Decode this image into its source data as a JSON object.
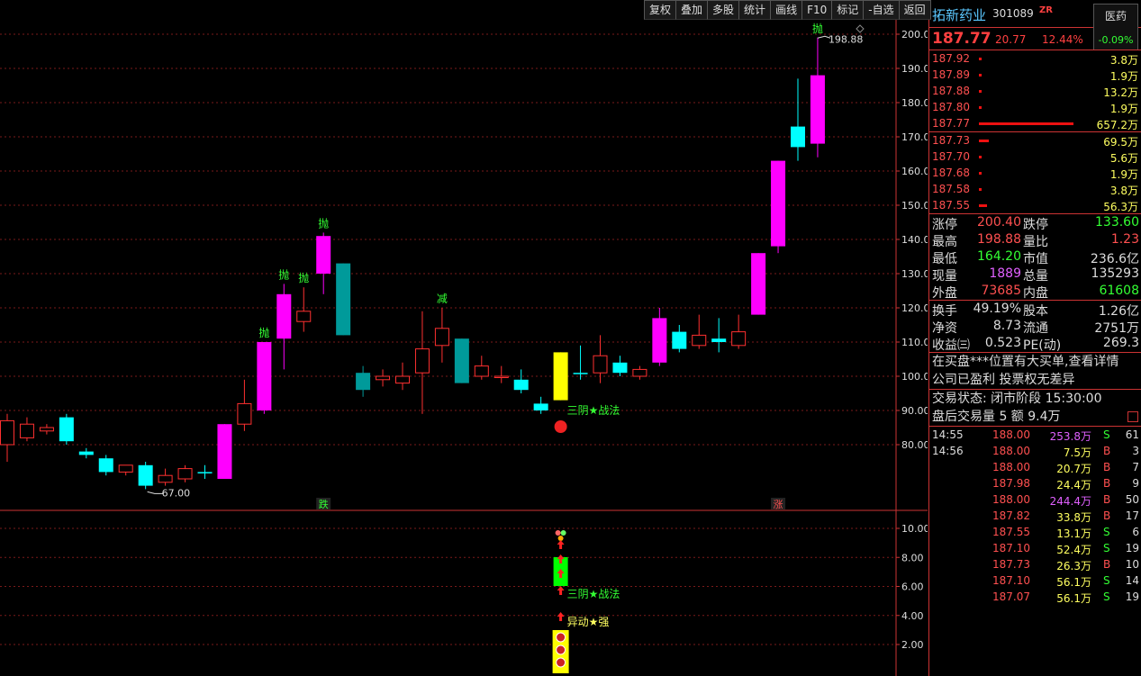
{
  "toolbar": [
    "复权",
    "叠加",
    "多股",
    "统计",
    "画线",
    "F10",
    "标记",
    "-自选",
    "返回"
  ],
  "stock": {
    "name": "拓新药业",
    "code": "301089",
    "tag": "ZR",
    "sector": "医药",
    "sector_change": "-0.09%",
    "price": "187.77",
    "change": "20.77",
    "change_pct": "12.44%"
  },
  "order_book": [
    {
      "price": "187.92",
      "vol": "3.8万",
      "bar": 0.01
    },
    {
      "price": "187.89",
      "vol": "1.9万",
      "bar": 0.01
    },
    {
      "price": "187.88",
      "vol": "13.2万",
      "bar": 0.01
    },
    {
      "price": "187.80",
      "vol": "1.9万",
      "bar": 0.01
    },
    {
      "price": "187.77",
      "vol": "657.2万",
      "bar": 0.95
    },
    {
      "price": "187.73",
      "vol": "69.5万",
      "bar": 0.1
    },
    {
      "price": "187.70",
      "vol": "5.6万",
      "bar": 0.01
    },
    {
      "price": "187.68",
      "vol": "1.9万",
      "bar": 0.01
    },
    {
      "price": "187.58",
      "vol": "3.8万",
      "bar": 0.01
    },
    {
      "price": "187.55",
      "vol": "56.3万",
      "bar": 0.08
    }
  ],
  "stats": [
    [
      {
        "l": "涨停",
        "v": "200.40",
        "c": "#ff5050"
      },
      {
        "l": "跌停",
        "v": "133.60",
        "c": "#3f3"
      }
    ],
    [
      {
        "l": "最高",
        "v": "198.88",
        "c": "#ff5050"
      },
      {
        "l": "量比",
        "v": "1.23",
        "c": "#ff5050"
      }
    ],
    [
      {
        "l": "最低",
        "v": "164.20",
        "c": "#3f3"
      },
      {
        "l": "市值",
        "v": "236.6亿",
        "c": "#ddd"
      }
    ],
    [
      {
        "l": "现量",
        "v": "1889",
        "c": "#e060ff"
      },
      {
        "l": "总量",
        "v": "135293",
        "c": "#ddd"
      }
    ],
    [
      {
        "l": "外盘",
        "v": "73685",
        "c": "#ff5050"
      },
      {
        "l": "内盘",
        "v": "61608",
        "c": "#3f3"
      }
    ],
    [
      {
        "l": "换手",
        "v": "49.19%",
        "c": "#ddd"
      },
      {
        "l": "股本",
        "v": "1.26亿",
        "c": "#ddd"
      }
    ],
    [
      {
        "l": "净资",
        "v": "8.73",
        "c": "#ddd"
      },
      {
        "l": "流通",
        "v": "2751万",
        "c": "#ddd"
      }
    ],
    [
      {
        "l": "收益㈢",
        "v": "0.523",
        "c": "#ddd"
      },
      {
        "l": "PE(动)",
        "v": "269.3",
        "c": "#ddd"
      }
    ]
  ],
  "notices": [
    "在买盘***位置有大买单,查看详情",
    "公司已盈利 投票权无差异"
  ],
  "trade_status": "交易状态: 闭市阶段 15:30:00",
  "after_hours": "盘后交易量 5 额 9.4万",
  "ticks": [
    {
      "t": "14:55",
      "p": "188.00",
      "v": "253.8万",
      "s": "S",
      "n": "61",
      "vc": "#e060ff"
    },
    {
      "t": "14:56",
      "p": "188.00",
      "v": "7.5万",
      "s": "B",
      "n": "3",
      "vc": "#ffff60"
    },
    {
      "t": "",
      "p": "188.00",
      "v": "20.7万",
      "s": "B",
      "n": "7",
      "vc": "#ffff60"
    },
    {
      "t": "",
      "p": "187.98",
      "v": "24.4万",
      "s": "B",
      "n": "9",
      "vc": "#ffff60"
    },
    {
      "t": "",
      "p": "188.00",
      "v": "244.4万",
      "s": "B",
      "n": "50",
      "vc": "#e060ff"
    },
    {
      "t": "",
      "p": "187.82",
      "v": "33.8万",
      "s": "B",
      "n": "17",
      "vc": "#ffff60"
    },
    {
      "t": "",
      "p": "187.55",
      "v": "13.1万",
      "s": "S",
      "n": "6",
      "vc": "#ffff60"
    },
    {
      "t": "",
      "p": "187.10",
      "v": "52.4万",
      "s": "S",
      "n": "19",
      "vc": "#ffff60"
    },
    {
      "t": "",
      "p": "187.73",
      "v": "26.3万",
      "s": "B",
      "n": "10",
      "vc": "#ffff60"
    },
    {
      "t": "",
      "p": "187.10",
      "v": "56.1万",
      "s": "S",
      "n": "14",
      "vc": "#ffff60"
    },
    {
      "t": "",
      "p": "187.07",
      "v": "56.1万",
      "s": "S",
      "n": "19",
      "vc": "#ffff60"
    }
  ],
  "chart_data": {
    "type": "candlestick",
    "y_ticks": [
      "200.0",
      "190.0",
      "180.0",
      "170.0",
      "160.0",
      "150.0",
      "140.0",
      "130.0",
      "120.0",
      "110.0",
      "100.0",
      "90.00",
      "80.00"
    ],
    "ylim": [
      74,
      203
    ],
    "ind_ticks": [
      "10.00",
      "8.00",
      "6.00",
      "4.00",
      "2.00"
    ],
    "ind_ylim": [
      0,
      11
    ],
    "high_label": "198.88",
    "low_label": "67.00",
    "candles": [
      {
        "o": 80,
        "h": 89,
        "l": 75,
        "c": 87,
        "k": "r"
      },
      {
        "o": 82,
        "h": 88,
        "l": 81,
        "c": 86,
        "k": "r"
      },
      {
        "o": 84,
        "h": 86,
        "l": 83,
        "c": 85,
        "k": "r"
      },
      {
        "o": 88,
        "h": 89,
        "l": 80,
        "c": 81,
        "k": "c"
      },
      {
        "o": 78,
        "h": 79,
        "l": 76,
        "c": 77,
        "k": "c"
      },
      {
        "o": 76,
        "h": 77,
        "l": 71,
        "c": 72,
        "k": "c"
      },
      {
        "o": 72,
        "h": 74,
        "l": 71,
        "c": 74,
        "k": "r"
      },
      {
        "o": 74,
        "h": 75,
        "l": 67,
        "c": 68,
        "k": "c"
      },
      {
        "o": 69,
        "h": 73,
        "l": 68,
        "c": 71,
        "k": "r"
      },
      {
        "o": 70,
        "h": 74,
        "l": 69,
        "c": 73,
        "k": "r"
      },
      {
        "o": 72,
        "h": 74,
        "l": 70,
        "c": 72,
        "k": "c"
      },
      {
        "o": 70,
        "h": 86,
        "l": 70,
        "c": 86,
        "k": "m"
      },
      {
        "o": 86,
        "h": 99,
        "l": 84,
        "c": 92,
        "k": "r"
      },
      {
        "o": 90,
        "h": 110,
        "l": 89,
        "c": 110,
        "k": "m"
      },
      {
        "o": 111,
        "h": 127,
        "l": 102,
        "c": 124,
        "k": "m"
      },
      {
        "o": 116,
        "h": 126,
        "l": 113,
        "c": 119,
        "k": "r"
      },
      {
        "o": 130,
        "h": 142,
        "l": 124,
        "c": 141,
        "k": "m"
      },
      {
        "o": 133,
        "h": 133,
        "l": 112,
        "c": 112,
        "k": "t"
      },
      {
        "o": 101,
        "h": 103,
        "l": 94,
        "c": 96,
        "k": "t"
      },
      {
        "o": 99,
        "h": 102,
        "l": 97,
        "c": 100,
        "k": "r"
      },
      {
        "o": 98,
        "h": 104,
        "l": 96,
        "c": 100,
        "k": "r"
      },
      {
        "o": 101,
        "h": 119,
        "l": 89,
        "c": 108,
        "k": "r"
      },
      {
        "o": 109,
        "h": 120,
        "l": 104,
        "c": 114,
        "k": "r"
      },
      {
        "o": 111,
        "h": 111,
        "l": 98,
        "c": 98,
        "k": "t"
      },
      {
        "o": 100,
        "h": 106,
        "l": 99,
        "c": 103,
        "k": "r"
      },
      {
        "o": 100,
        "h": 103,
        "l": 98,
        "c": 100,
        "k": "r"
      },
      {
        "o": 99,
        "h": 102,
        "l": 95,
        "c": 96,
        "k": "c"
      },
      {
        "o": 92,
        "h": 94,
        "l": 89,
        "c": 90,
        "k": "c"
      },
      {
        "o": 93,
        "h": 107,
        "l": 93,
        "c": 107,
        "k": "y"
      },
      {
        "o": 101,
        "h": 109,
        "l": 99,
        "c": 101,
        "k": "c"
      },
      {
        "o": 101,
        "h": 112,
        "l": 98,
        "c": 106,
        "k": "r"
      },
      {
        "o": 104,
        "h": 106,
        "l": 100,
        "c": 101,
        "k": "c"
      },
      {
        "o": 100,
        "h": 103,
        "l": 99,
        "c": 102,
        "k": "r"
      },
      {
        "o": 104,
        "h": 120,
        "l": 103,
        "c": 117,
        "k": "m"
      },
      {
        "o": 113,
        "h": 115,
        "l": 107,
        "c": 108,
        "k": "c"
      },
      {
        "o": 109,
        "h": 118,
        "l": 108,
        "c": 112,
        "k": "r"
      },
      {
        "o": 110,
        "h": 117,
        "l": 107,
        "c": 111,
        "k": "c"
      },
      {
        "o": 109,
        "h": 118,
        "l": 108,
        "c": 113,
        "k": "r"
      },
      {
        "o": 118,
        "h": 136,
        "l": 118,
        "c": 136,
        "k": "m"
      },
      {
        "o": 138,
        "h": 163,
        "l": 136,
        "c": 163,
        "k": "m"
      },
      {
        "o": 173,
        "h": 187,
        "l": 163,
        "c": 167,
        "k": "c"
      },
      {
        "o": 168,
        "h": 199,
        "l": 164,
        "c": 188,
        "k": "m"
      }
    ],
    "signals": [
      {
        "i": 13,
        "text": "抛"
      },
      {
        "i": 14,
        "text": "抛"
      },
      {
        "i": 15,
        "text": "抛"
      },
      {
        "i": 16,
        "text": "抛"
      },
      {
        "i": 22,
        "text": "减"
      },
      {
        "i": 41,
        "text": "抛"
      }
    ],
    "labels": {
      "sanyin": "三阴★战法",
      "die": "跌",
      "zhang": "涨",
      "yidong": "异动★强"
    }
  }
}
